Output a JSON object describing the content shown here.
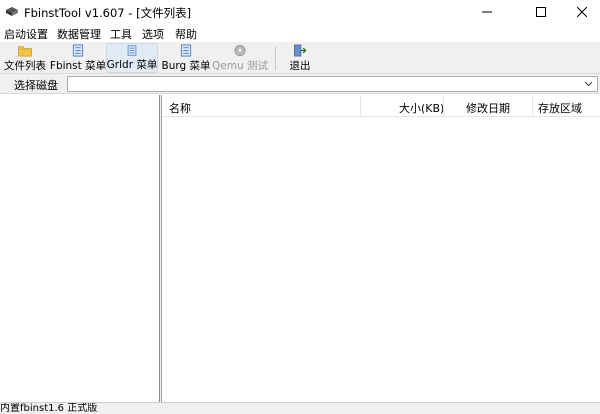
{
  "window": {
    "title": "FbinstTool v1.607 - [文件列表]"
  },
  "menu": {
    "items": [
      "启动设置",
      "数据管理",
      "工具",
      "选项",
      "帮助"
    ]
  },
  "toolbar": {
    "buttons": [
      {
        "label": "文件列表",
        "icon": "folder-icon"
      },
      {
        "label": "Fbinst 菜单",
        "icon": "menu-page-icon"
      },
      {
        "label": "Grldr 菜单",
        "icon": "menu-page-icon"
      },
      {
        "label": "Burg 菜单",
        "icon": "menu-page-icon"
      },
      {
        "label": "Qemu 测试",
        "icon": "qemu-icon"
      },
      {
        "label": "退出",
        "icon": "exit-icon"
      }
    ]
  },
  "disk": {
    "label": "选择磁盘",
    "selected": ""
  },
  "file_list": {
    "columns": [
      "名称",
      "大小(KB)",
      "修改日期",
      "存放区域"
    ],
    "rows": []
  },
  "status": {
    "text": "内置fbinst1.6 正式版"
  },
  "colors": {
    "toolbar_bg": "#f0f0f0",
    "active_button_bg": "#e1ebf6",
    "folder_icon": "#f4c542",
    "page_icon": "#4a7cc4"
  }
}
